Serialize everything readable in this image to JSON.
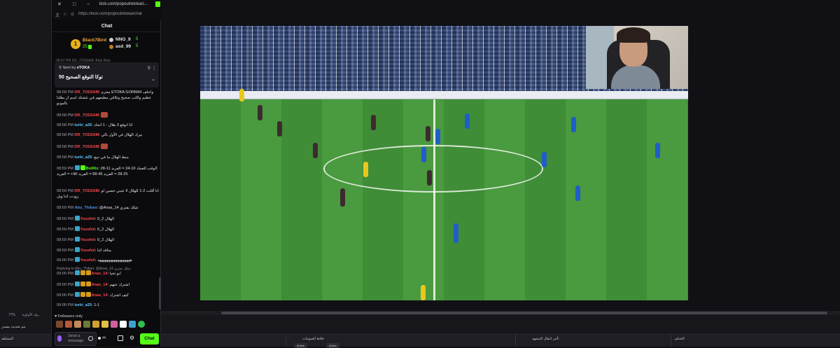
{
  "window": {
    "url": "https://kick.com/popout/etoka/chat",
    "url_short": "kick.com/popout/etoka/c..."
  },
  "chat": {
    "header": "Chat",
    "leaderboard": {
      "rank": "1",
      "first": {
        "name": "Black7Bird",
        "count": "25"
      },
      "second": {
        "name": "NNO_9",
        "count": "5"
      },
      "third": {
        "name": "asd_99",
        "count": "5"
      }
    },
    "ghost_line": "08:57 PM DR_7OSSAM: Blah Blah",
    "pinned": {
      "sent_by_label": "Sent by",
      "sender": "eTOKA",
      "message": "توكا التوقع الصحيح 50"
    },
    "messages": [
      {
        "time": "08:58 PM",
        "user": "DR_7OSSAM",
        "color": "#ff4747",
        "text": "مجرم ETOKA GORMHI واحلف عظيم واللب صحيح وتلاقي مطيعهم في عشتك اسم از يطلنا بالمونو"
      },
      {
        "time": "08:58 PM",
        "user": "DR_7OSSAM",
        "color": "#ff4747",
        "text": ""
      },
      {
        "time": "08:58 PM",
        "user": "turki_a25",
        "color": "#5ec8ff",
        "text": "انا اتوقع 3 هلال - 1 اتحاد"
      },
      {
        "time": "08:58 PM",
        "user": "DR_7OSSAM",
        "color": "#ff4747",
        "text": "بيرك الهلال في الأول بالي"
      },
      {
        "time": "08:58 PM",
        "user": "DR_7OSSAM",
        "color": "#ff4747",
        "text": ""
      },
      {
        "time": "08:58 PM",
        "user": "turki_a25",
        "color": "#5ec8ff",
        "text": "بنبط الهلال ما في نبيع"
      },
      {
        "time": "08:59 PM",
        "user": "BotRix",
        "color": "#53fc18",
        "text": "الوقت للعماد 10-24 = الفريد 11-28 25-28 = الفريد 45-68 = الفريد 90+ = الفريد"
      },
      {
        "time": "08:59 PM",
        "user": "DR_7OSSAM",
        "color": "#ff4747",
        "text": "انا أقلت 2-1 للهلال لا عيني حضين لو زودت اثنا ويل"
      },
      {
        "time": "08:59 PM",
        "user": "Abu_Thiban",
        "color": "#4a8fe0",
        "text": "@Anas_14 عيلك يفتري"
      },
      {
        "time": "08:59 PM",
        "user": "Yousfeii",
        "color": "#ff4747",
        "text": "الهلال 2_0"
      },
      {
        "time": "08:59 PM",
        "user": "Yousfeii",
        "color": "#ff4747",
        "text": "الهلال 2_0"
      },
      {
        "time": "08:59 PM",
        "user": "Yousfeii",
        "color": "#ff4747",
        "text": "الهلال 2_0"
      },
      {
        "time": "08:59 PM",
        "user": "Yousfeii",
        "color": "#ff4747",
        "text": "متاقد اثنا"
      },
      {
        "time": "09:00 PM",
        "user": "Yousfeii",
        "color": "#ff4747",
        "text": "ههههههههههههههههههه"
      },
      {
        "time": "09:00 PM",
        "user": "Anas_14",
        "color": "#ff4747",
        "text": "ابو تحيا"
      },
      {
        "time": "09:00 PM",
        "user": "Anas_14",
        "color": "#ff4747",
        "text": "اشترك عنهم"
      },
      {
        "time": "09:00 PM",
        "user": "Anas_14",
        "color": "#ff4747",
        "text": "كيف اشترك"
      },
      {
        "time": "09:00 PM",
        "user": "turki_a25",
        "color": "#5ec8ff",
        "text": "1-1"
      }
    ],
    "reply_hint": "Replying to Abu_Thiban: @Anas_14 عيلك يفتري",
    "followers_only": "Followers only",
    "input_placeholder": "Send a message",
    "infinity_label": "∞",
    "send_button": "Chat"
  },
  "status": {
    "line1": "ولد الأولوية...",
    "zoom": "77%",
    "line2": "يتم تحديث مصدر"
  },
  "docks": {
    "left": "المشاهد",
    "mixer": "خلاط الصوتيات",
    "mixer_buttons": [
      "Active",
      "Active"
    ],
    "transitions": "تأثير انتقال المشهد",
    "controls": "التحكم"
  }
}
